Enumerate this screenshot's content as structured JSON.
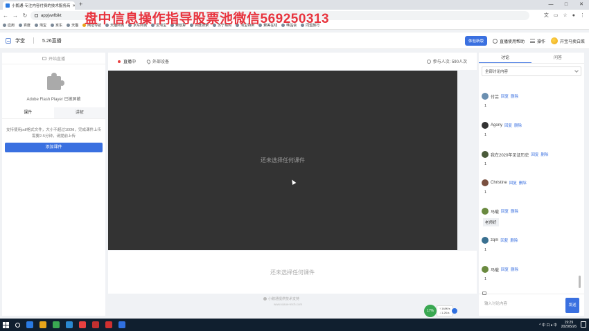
{
  "browser": {
    "tab_title": "小鹅通-专注内容付费的技术服务商",
    "url": "appjvwfbikt",
    "watermark": "盘中信息操作指导股票池微信569250313",
    "window_controls": [
      "—",
      "□",
      "✕"
    ],
    "bookmarks": [
      "应用",
      "百度",
      "淘宝",
      "京东",
      "天猫",
      "网址导航",
      "天猫商城",
      "京东商城",
      "爱淘宝",
      "聚划算",
      "百度搜索",
      "苏宁易购",
      "淘宝特卖",
      "聚美在线",
      "唯品会",
      "同盟旅行"
    ]
  },
  "header": {
    "app_name": "学堂",
    "live_name": "5.26直播",
    "trial_label": "体验新版",
    "help_label": "直播使用帮助",
    "ops_label": "操作",
    "user_name": "开宝马卖白菜"
  },
  "left": {
    "start_live": "开始直播",
    "flash_notice": "Adobe Flash Player 已被屏蔽",
    "tabs": [
      "课件",
      "讲解"
    ],
    "upload_hint": "支持使用pdf格式文件，大小不超过100M，完成课件上传需要2-5分钟，请提前上传",
    "add_button": "添加课件"
  },
  "center": {
    "status": "直播中",
    "external": "外部设备",
    "participants": "参与人次: 590人次",
    "video_placeholder": "还未选择任何课件",
    "doc_placeholder": "还未选择任何课件",
    "powered_by": "小鹅通提供技术支持",
    "powered_url": "www.xiaoe-tech.com",
    "net_percent": "17%",
    "net_up": "↑ 148K/s",
    "net_down": "↓ 1.2K/s"
  },
  "right": {
    "tabs": [
      "讨论",
      "问答"
    ],
    "filter": "全部讨论内容",
    "reply_label": "回复",
    "delete_label": "删除",
    "messages": [
      {
        "name": "付芸",
        "text": "1",
        "avatar_color": "#6b8fb0"
      },
      {
        "name": "Agony",
        "text": "1",
        "avatar_color": "#333333"
      },
      {
        "name": "我在2020年见证历史",
        "text": "1",
        "avatar_color": "#4a5a3a"
      },
      {
        "name": "Christine",
        "text": "1",
        "avatar_color": "#7a5040"
      },
      {
        "name": "马载",
        "text": "老师好",
        "avatar_color": "#6a8a40"
      },
      {
        "name": "zqm",
        "text": "1",
        "avatar_color": "#3a7090"
      },
      {
        "name": "马载",
        "text": "1",
        "avatar_color": "#6a8a40"
      }
    ],
    "input_placeholder": "输入讨论内容",
    "send_label": "发送"
  },
  "taskbar": {
    "time": "19:29",
    "date": "2020/5/26",
    "tray_text": "^ 中 口 ♦ 中",
    "app_colors": [
      "#2a7ae2",
      "#e8a51a",
      "#3aa852",
      "#2a88d0",
      "#e84040",
      "#c23030",
      "#d03030",
      "#3070e0"
    ]
  }
}
